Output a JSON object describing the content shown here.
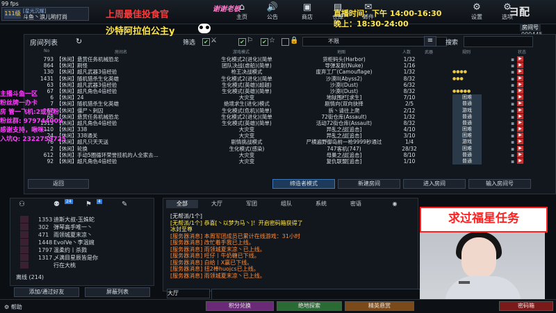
{
  "hud": {
    "fps": "99 fps"
  },
  "player": {
    "level": "111级",
    "tag": "[星光沉耀]",
    "name": "斗鱼丶浪儿哟打尚"
  },
  "overlay": {
    "line1": "上周最佳投食官",
    "line2": "沙特阿拉伯公主y",
    "sticker": "谢谢老板"
  },
  "nav": [
    {
      "icon": "home-icon",
      "glyph": "⌂",
      "label": "主页"
    },
    {
      "icon": "speaker-icon",
      "glyph": "🔊",
      "label": "公告"
    },
    {
      "icon": "shop-icon",
      "glyph": "▣",
      "label": "商店"
    },
    {
      "icon": "bag-icon",
      "glyph": "▤",
      "label": "仓库"
    },
    {
      "icon": "mail-icon",
      "glyph": "✉",
      "label": "邮件"
    },
    {
      "icon": "settings-icon",
      "glyph": "⚙",
      "label": "设置"
    },
    {
      "icon": "gear-icon",
      "glyph": "⚙",
      "label": "选项"
    }
  ],
  "schedule": {
    "line1": "直播时间：下午 14:00-16:30",
    "line2": "晚上：18:30-24:00"
  },
  "brand": {
    "logo": "ヨ配"
  },
  "room_no": {
    "label": "房间号",
    "value": "000445"
  },
  "room_list": {
    "title": "房间列表",
    "filter_label": "筛选",
    "limit_value": "不限",
    "search_label": "搜索",
    "search_value": "",
    "headers": {
      "no": "No",
      "name": "房间名",
      "mode": "游戏模式",
      "map": "地图",
      "count": "人数",
      "weapon": "武器",
      "rule": "规则",
      "status": "状态"
    },
    "rows": [
      {
        "no": "793",
        "name": "【休闲】悬赏任务机械恐龙",
        "mode": "生化模式2(进化)(简单",
        "map": "货柜码头(Harbor)",
        "count": "1/32",
        "icons": "",
        "tag": ""
      },
      {
        "no": "864",
        "name": "【休闲】刷怪",
        "mode": "团队决战(虐船)(简单)",
        "map": "导弹发射(Nuke)",
        "count": "1/16",
        "icons": "",
        "tag": ""
      },
      {
        "no": "130",
        "name": "【休闲】超凡武器3倍经验",
        "mode": "枪王决战模式",
        "map": "废弃工厂(Camouflage)",
        "count": "1/32",
        "icons": "●●●●",
        "tag": ""
      },
      {
        "no": "1431",
        "name": "【休闲】随机猎杀生化英雄",
        "mode": "生化模式2(进化)(简单",
        "map": "沙漠II(Abyss2)",
        "count": "8/32",
        "icons": "●●●",
        "tag": ""
      },
      {
        "no": "63",
        "name": "【休闲】超凡武器3倍经验",
        "mode": "生化模式(英雄)(超越)",
        "map": "沙漠I(Dust)",
        "count": "6/32",
        "icons": "",
        "tag": ""
      },
      {
        "no": "67",
        "name": "【休闲】超凡角色4倍经验",
        "mode": "生化模式(英雄)(简单)",
        "map": "沙漠I(Dust)",
        "count": "8/32",
        "icons": "●●●●●",
        "tag": ""
      },
      {
        "no": "6",
        "name": "【休闲】24",
        "mode": "大灾变",
        "map": "地狱围栏[求生]",
        "count": "7/10",
        "icons": "",
        "tag": "困难"
      },
      {
        "no": "7",
        "name": "【休闲】随机猎杀生化英雄",
        "mode": "绝境求生(进化)模式",
        "map": "剧情向(双向抉择",
        "count": "2/5",
        "icons": "",
        "tag": "普通"
      },
      {
        "no": "67",
        "name": "【休闲】僵尸丶刺囚",
        "mode": "生化模式(危机)(简单)",
        "map": "拆丶请往上爬",
        "count": "2/12",
        "icons": "●●",
        "tag": "游戏"
      },
      {
        "no": "68",
        "name": "【休闲】悬赏任务机械恐龙",
        "mode": "生化模式2(进化)(简单",
        "map": "72街仓库(Assault)",
        "count": "1/32",
        "icons": "",
        "tag": "普通"
      },
      {
        "no": "1313",
        "name": "【休闲】超凡角色4倍经验",
        "mode": "生化模式(英雄)(简单)",
        "map": "活动72街仓库(Assault)",
        "count": "8/32",
        "icons": "",
        "tag": "普通"
      },
      {
        "no": "110",
        "name": "【休闲】338",
        "mode": "大灾变",
        "map": "异乱之战[追击]",
        "count": "4/10",
        "icons": "",
        "tag": "困难"
      },
      {
        "no": "24",
        "name": "【休闲】338通关",
        "mode": "大灾变",
        "map": "异乱之战[追击]",
        "count": "3/10",
        "icons": "",
        "tag": "困难"
      },
      {
        "no": "76",
        "name": "【休闲】超凡只天天送",
        "mode": "剧情挑战模式",
        "map": "尸横遍野御岛前一枪9999秒通过",
        "count": "1/4",
        "icons": "",
        "tag": "游戏"
      },
      {
        "no": "2",
        "name": "【休闲】轮换",
        "mode": "生化模式(感染)",
        "map": "747客机(747)",
        "count": "28/32",
        "icons": "",
        "tag": "困难"
      },
      {
        "no": "612",
        "name": "【休闲】手动5圈循环荣誉挂机的人全家去...",
        "mode": "大灾变",
        "map": "母巢之战[追击]",
        "count": "8/10",
        "icons": "",
        "tag": "普通"
      },
      {
        "no": "92",
        "name": "【休闲】超凡角色4倍经验",
        "mode": "大灾变",
        "map": "复仇联盟[追击]",
        "count": "1/10",
        "icons": "",
        "tag": "普通"
      }
    ],
    "buttons": {
      "back": "返回",
      "mode": "缔造者模式",
      "create": "新建房间",
      "enter": "进入房间",
      "enter_no": "输入房间号"
    }
  },
  "streamer_info": [
    "主播斗鱼一区",
    "粉丝牌一办卡",
    "房  管一飞机:2或钻粉",
    "粉丝群: 979744009",
    "感谢支持，啾咪~",
    "入坑Q: 2322759725"
  ],
  "friends": {
    "tabs": [
      {
        "icon": "person-icon",
        "glyph": "⚇"
      },
      {
        "icon": "group-icon",
        "glyph": "⚉",
        "badge": "24"
      },
      {
        "icon": "clan-icon",
        "glyph": "⚑",
        "badge": "4"
      },
      {
        "icon": "edit-icon",
        "glyph": "✎"
      }
    ],
    "list": [
      {
        "level": "1353",
        "name": "迪斯大叔-玉姝蛇"
      },
      {
        "level": "302",
        "name": "弹琴高手唯一丶"
      },
      {
        "level": "471",
        "name": "雨领城夏末凉丶"
      },
      {
        "level": "1448",
        "name": "EvolVe丶李温婉"
      },
      {
        "level": "1797",
        "name": "温柔约丨杀戮"
      },
      {
        "level": "1317",
        "name": "乄满目星辰皆是你"
      },
      {
        "level": "",
        "name": "行在大桃"
      }
    ],
    "offline_label": "离线 (214)",
    "add_button": "添加/通过好友",
    "mask_button": "屏蔽列表"
  },
  "chat": {
    "tabs": [
      "全部",
      "大厅",
      "军团",
      "组队",
      "系统",
      "密语"
    ],
    "messages": [
      {
        "kind": "b",
        "text": "[无帮派/1个]"
      },
      {
        "kind": "y",
        "text": "[无帮派/1个]  恭喜[丶以梦为马丶]！开启密码箱获得了"
      },
      {
        "kind": "y",
        "text": "冰封至尊"
      },
      {
        "kind": "t",
        "text": "[服务器消息] 本周军团成员已累计在线游戏：31小时"
      },
      {
        "kind": "t",
        "text": "[服务器消息] 改忙着手我已上线。"
      },
      {
        "kind": "t",
        "text": "[服务器消息] 雨领城夏末凉丶已上线。"
      },
      {
        "kind": "t",
        "text": "[服务器消息] 旺仔丨牛奶糖已下线。"
      },
      {
        "kind": "t",
        "text": "[服务器消息] 白给丨X赢已下线。"
      },
      {
        "kind": "t",
        "text": "[服务器消息] 扭2棒huojcs已上线。"
      },
      {
        "kind": "t",
        "text": "[服务器消息] 雨领城夏末凉丶已上线。"
      }
    ],
    "channel": "大厅",
    "input_value": ""
  },
  "webcam": {
    "banner": "求过福星任务"
  },
  "bottom": {
    "help": "帮助",
    "buttons": [
      {
        "label": "积分兑换",
        "color": "#6b2a78"
      },
      {
        "label": "绝地探索",
        "color": "#2a6a34"
      },
      {
        "label": "精英悬赏",
        "color": "#7a4a1a"
      },
      {
        "label": "密码箱",
        "color": "#7a1a1a"
      }
    ]
  }
}
